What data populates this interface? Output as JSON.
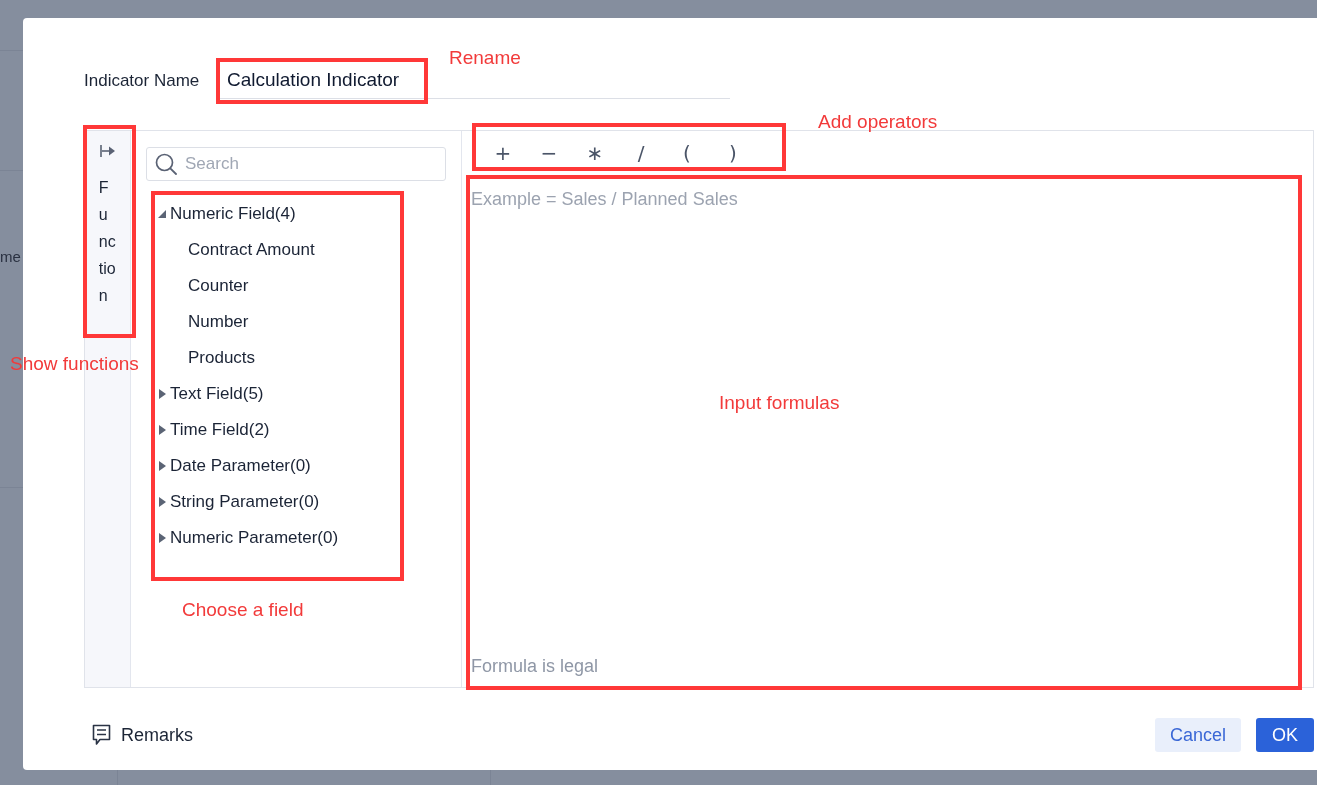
{
  "background": {
    "partial_label": "me"
  },
  "name_field": {
    "label": "Indicator Name",
    "value": "Calculation Indicator"
  },
  "function_panel": {
    "label": "Function"
  },
  "search": {
    "placeholder": "Search"
  },
  "field_tree": [
    {
      "label": "Numeric Field(4)",
      "expanded": true,
      "children": [
        {
          "label": "Contract Amount"
        },
        {
          "label": "Counter"
        },
        {
          "label": "Number"
        },
        {
          "label": "Products"
        }
      ]
    },
    {
      "label": "Text Field(5)",
      "expanded": false
    },
    {
      "label": "Time Field(2)",
      "expanded": false
    },
    {
      "label": "Date Parameter(0)",
      "expanded": false
    },
    {
      "label": "String Parameter(0)",
      "expanded": false
    },
    {
      "label": "Numeric Parameter(0)",
      "expanded": false
    }
  ],
  "operators": [
    "+",
    "−",
    "∗",
    "/",
    "(",
    ")"
  ],
  "formula_editor": {
    "placeholder": "Example = Sales / Planned Sales",
    "status": "Formula is legal"
  },
  "remarks": {
    "label": "Remarks"
  },
  "buttons": [
    {
      "label": "Cancel",
      "kind": "secondary"
    },
    {
      "label": "OK",
      "kind": "primary"
    }
  ],
  "annotations": [
    {
      "label": "Rename",
      "kind": "name"
    },
    {
      "label": "Add operators",
      "kind": "operators"
    },
    {
      "label": "Show functions",
      "kind": "functions"
    },
    {
      "label": "Input formulas",
      "kind": "formula"
    },
    {
      "label": "Choose a field",
      "kind": "fields"
    }
  ]
}
